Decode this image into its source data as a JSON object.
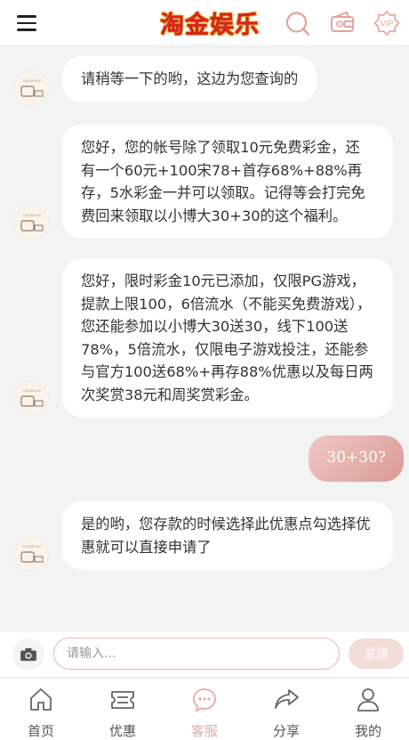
{
  "header": {
    "logo_text": "淘金娱乐",
    "icons": [
      "menu-icon",
      "search-icon",
      "wallet-icon",
      "vip-icon"
    ],
    "vip_label": "VIP"
  },
  "colors": {
    "accent": "#e3aaa4",
    "user_bubble": "#d99a95",
    "logo_red": "#d9241c"
  },
  "messages": [
    {
      "from": "agent",
      "text": "请稍等一下的哟，这边为您查询的"
    },
    {
      "from": "agent",
      "text": "您好，您的帐号除了领取10元免费彩金，还有一个60元+100宋78+首存68%+88%再存，5水彩金一并可以领取。记得等会打完免费回来领取以小博大30+30的这个福利。"
    },
    {
      "from": "agent",
      "text": "您好，限时彩金10元已添加，仅限PG游戏，提款上限100，6倍流水（不能买免费游戏），您还能参加以小博大30送30，线下100送78%，5倍流水，仅限电子游戏投注，还能参与官方100送68%+再存88%优惠以及每日两次奖赏38元和周奖赏彩金。"
    },
    {
      "from": "user",
      "text": "30+30?"
    },
    {
      "from": "agent",
      "text": "是的哟，您存款的时候选择此优惠点勾选择优惠就可以直接申请了"
    }
  ],
  "input": {
    "placeholder": "请输入...",
    "value": "",
    "send_label": "发送"
  },
  "tabs": [
    {
      "label": "首页",
      "icon": "home-icon",
      "active": false
    },
    {
      "label": "优惠",
      "icon": "ticket-icon",
      "active": false
    },
    {
      "label": "客服",
      "icon": "chat-icon",
      "active": true
    },
    {
      "label": "分享",
      "icon": "share-icon",
      "active": false
    },
    {
      "label": "我的",
      "icon": "user-icon",
      "active": false
    }
  ]
}
